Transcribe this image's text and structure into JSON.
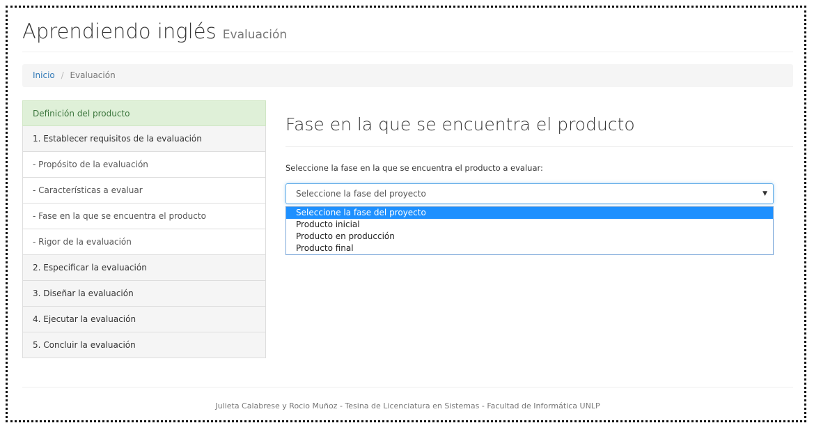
{
  "header": {
    "title": "Aprendiendo inglés",
    "subtitle": "Evaluación"
  },
  "breadcrumb": {
    "home": "Inicio",
    "separator": "/",
    "current": "Evaluación"
  },
  "sidebar": {
    "items": [
      {
        "label": "Definición del producto",
        "type": "active"
      },
      {
        "label": "1. Establecer requisitos de la evaluación",
        "type": "group"
      },
      {
        "label": "- Propósito de la evaluación",
        "type": "sub"
      },
      {
        "label": "- Características a evaluar",
        "type": "sub"
      },
      {
        "label": "- Fase en la que se encuentra el producto",
        "type": "sub"
      },
      {
        "label": "- Rigor de la evaluación",
        "type": "sub"
      },
      {
        "label": "2. Especificar la evaluación",
        "type": "group"
      },
      {
        "label": "3. Diseñar la evaluación",
        "type": "group"
      },
      {
        "label": "4. Ejecutar la evaluación",
        "type": "group"
      },
      {
        "label": "5. Concluir la evaluación",
        "type": "group"
      }
    ]
  },
  "main": {
    "title": "Fase en la que se encuentra el producto",
    "label": "Seleccione la fase en la que se encuentra el producto a evaluar:",
    "select": {
      "value": "Seleccione la fase del proyecto",
      "arrow_icon": "caret-down-icon",
      "options": [
        "Seleccione la fase del proyecto",
        "Producto inicial",
        "Producto en producción",
        "Producto final"
      ],
      "highlighted_option": 0
    }
  },
  "footer": {
    "text": "Julieta Calabrese y Rocio Muñoz - Tesina de Licenciatura en Sistemas - Facultad de Informática UNLP"
  },
  "colors": {
    "active_bg": "#dff0d8",
    "active_text": "#3c763d",
    "link": "#337ab7",
    "option_highlight": "#1e90ff"
  }
}
